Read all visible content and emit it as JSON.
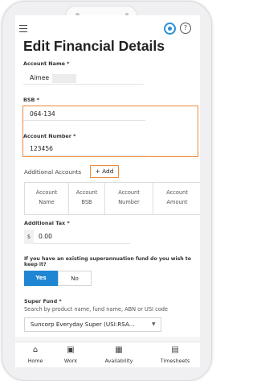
{
  "header": {
    "title": "Edit Financial Details"
  },
  "account_name": {
    "label": "Account Name *",
    "value": "Aimee"
  },
  "bsb": {
    "label": "BSB *",
    "value": "064-134"
  },
  "account_number": {
    "label": "Account Number *",
    "value": "123456"
  },
  "additional_accounts": {
    "label": "Additional Accounts",
    "add_label": "+ Add",
    "columns": [
      {
        "line1": "Account",
        "line2": "Name"
      },
      {
        "line1": "Account",
        "line2": "BSB"
      },
      {
        "line1": "Account",
        "line2": "Number"
      },
      {
        "line1": "Account",
        "line2": "Amount"
      }
    ]
  },
  "additional_tax": {
    "label": "Additional Tax *",
    "prefix": "$",
    "value": "0.00"
  },
  "super_question": {
    "text": "If you have an existing superannuation fund do you wish to keep it?",
    "yes": "Yes",
    "no": "No",
    "selected": "Yes"
  },
  "super_fund": {
    "label": "Super Fund *",
    "hint": "Search by product name, fund name, ABN or USI code",
    "value": "Suncorp Everyday Super (USI:RSA..."
  },
  "nav": {
    "items": [
      {
        "label": "Home",
        "icon": "home-icon"
      },
      {
        "label": "Work",
        "icon": "briefcase-icon"
      },
      {
        "label": "Availability",
        "icon": "calendar-icon"
      },
      {
        "label": "Timesheets",
        "icon": "timesheet-icon"
      }
    ]
  },
  "colors": {
    "accent": "#1f86d3",
    "highlight": "#ee8a3a"
  }
}
